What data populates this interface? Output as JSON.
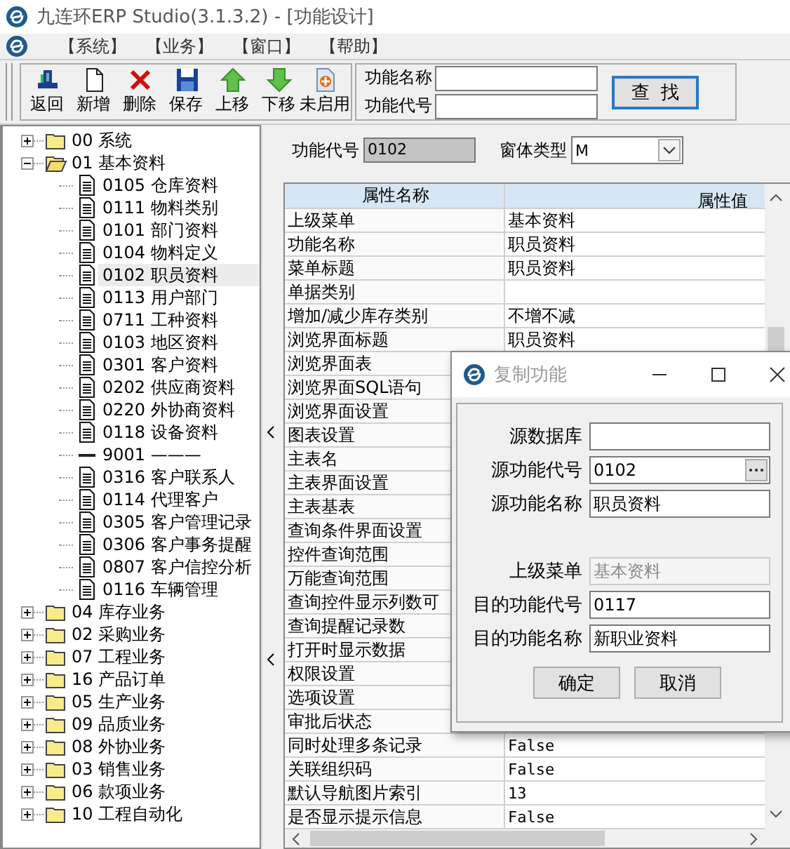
{
  "window": {
    "title": "九连环ERP Studio(3.1.3.2) - [功能设计]"
  },
  "menu": [
    "【系统】",
    "【业务】",
    "【窗口】",
    "【帮助】"
  ],
  "toolbar": [
    {
      "kind": "back",
      "label": "返回"
    },
    {
      "kind": "new",
      "label": "新增"
    },
    {
      "kind": "delete",
      "label": "删除"
    },
    {
      "kind": "save",
      "label": "保存"
    },
    {
      "kind": "up",
      "label": "上移"
    },
    {
      "kind": "down",
      "label": "下移"
    },
    {
      "kind": "disable",
      "label": "未启用"
    }
  ],
  "search": {
    "fields": [
      {
        "label": "功能名称"
      },
      {
        "label": "功能代号"
      }
    ],
    "button": "查  找"
  },
  "tree": [
    {
      "kind": "folder",
      "label": "00 系统",
      "expanded": false,
      "selected": false
    },
    {
      "kind": "folder",
      "label": "01 基本资料",
      "expanded": true,
      "selected": false,
      "children": [
        {
          "kind": "doc",
          "label": "0105 仓库资料",
          "selected": false
        },
        {
          "kind": "doc",
          "label": "0111 物料类别",
          "selected": false
        },
        {
          "kind": "doc",
          "label": "0101 部门资料",
          "selected": false
        },
        {
          "kind": "doc",
          "label": "0104 物料定义",
          "selected": false
        },
        {
          "kind": "doc",
          "label": "0102 职员资料",
          "selected": true
        },
        {
          "kind": "doc",
          "label": "0113 用户部门",
          "selected": false
        },
        {
          "kind": "doc",
          "label": "0711 工种资料",
          "selected": false
        },
        {
          "kind": "doc",
          "label": "0103 地区资料",
          "selected": false
        },
        {
          "kind": "doc",
          "label": "0301 客户资料",
          "selected": false
        },
        {
          "kind": "doc",
          "label": "0202 供应商资料",
          "selected": false
        },
        {
          "kind": "doc",
          "label": "0220 外协商资料",
          "selected": false
        },
        {
          "kind": "doc",
          "label": "0118 设备资料",
          "selected": false
        },
        {
          "kind": "separator",
          "label": "9001 ———",
          "selected": false
        },
        {
          "kind": "doc",
          "label": "0316 客户联系人",
          "selected": false
        },
        {
          "kind": "doc",
          "label": "0114 代理客户",
          "selected": false
        },
        {
          "kind": "doc",
          "label": "0305 客户管理记录",
          "selected": false
        },
        {
          "kind": "doc",
          "label": "0306 客户事务提醒",
          "selected": false
        },
        {
          "kind": "doc",
          "label": "0807 客户信控分析",
          "selected": false
        },
        {
          "kind": "doc",
          "label": "0116 车辆管理",
          "selected": false
        }
      ]
    },
    {
      "kind": "folder",
      "label": "04 库存业务",
      "expanded": false,
      "selected": false
    },
    {
      "kind": "folder",
      "label": "02 采购业务",
      "expanded": false,
      "selected": false
    },
    {
      "kind": "folder",
      "label": "07 工程业务",
      "expanded": false,
      "selected": false
    },
    {
      "kind": "folder",
      "label": "16 产品订单",
      "expanded": false,
      "selected": false
    },
    {
      "kind": "folder",
      "label": "05 生产业务",
      "expanded": false,
      "selected": false
    },
    {
      "kind": "folder",
      "label": "09 品质业务",
      "expanded": false,
      "selected": false
    },
    {
      "kind": "folder",
      "label": "08 外协业务",
      "expanded": false,
      "selected": false
    },
    {
      "kind": "folder",
      "label": "03 销售业务",
      "expanded": false,
      "selected": false
    },
    {
      "kind": "folder",
      "label": "06 款项业务",
      "expanded": false,
      "selected": false
    },
    {
      "kind": "folder",
      "label": "10 工程自动化",
      "expanded": false,
      "selected": false
    }
  ],
  "form": {
    "code_label": "功能代号",
    "code_value": "0102",
    "type_label": "窗体类型",
    "type_value": "M"
  },
  "grid": {
    "columns": [
      "属性名称",
      "属性值"
    ],
    "rows": [
      {
        "name": "上级菜单",
        "value": "基本资料"
      },
      {
        "name": "功能名称",
        "value": "职员资料"
      },
      {
        "name": "菜单标题",
        "value": "职员资料"
      },
      {
        "name": "单据类别"
      },
      {
        "name": "增加/减少库存类别",
        "value": "不增不减"
      },
      {
        "name": "浏览界面标题",
        "value": "职员资料"
      },
      {
        "name": "浏览界面表"
      },
      {
        "name": "浏览界面SQL语句"
      },
      {
        "name": "浏览界面设置"
      },
      {
        "name": "图表设置"
      },
      {
        "name": "主表名"
      },
      {
        "name": "主表界面设置"
      },
      {
        "name": "主表基表"
      },
      {
        "name": "查询条件界面设置"
      },
      {
        "name": "控件查询范围"
      },
      {
        "name": "万能查询范围"
      },
      {
        "name": "查询控件显示列数可"
      },
      {
        "name": "查询提醒记录数"
      },
      {
        "name": "打开时显示数据"
      },
      {
        "name": "权限设置"
      },
      {
        "name": "选项设置"
      },
      {
        "name": "审批后状态"
      },
      {
        "name": "同时处理多条记录",
        "value": "False"
      },
      {
        "name": "关联组织码",
        "value": "False"
      },
      {
        "name": "默认导航图片索引",
        "value": "13"
      },
      {
        "name": "是否显示提示信息",
        "value": "False"
      }
    ]
  },
  "dialog": {
    "title": "复制功能",
    "source_fields": [
      {
        "kind": "text",
        "label": "源数据库",
        "disabled": false
      },
      {
        "kind": "lookup",
        "label": "源功能代号",
        "value": "0102",
        "disabled": false
      },
      {
        "kind": "text",
        "label": "源功能名称",
        "value": "职员资料",
        "disabled": false
      }
    ],
    "target_fields": [
      {
        "kind": "text",
        "label": "上级菜单",
        "value": "基本资料",
        "disabled": true
      },
      {
        "kind": "text",
        "label": "目的功能代号",
        "value": "0117",
        "disabled": false
      },
      {
        "kind": "text",
        "label": "目的功能名称",
        "value": "新职业资料",
        "disabled": false
      }
    ],
    "buttons": [
      "确定",
      "取消"
    ]
  }
}
